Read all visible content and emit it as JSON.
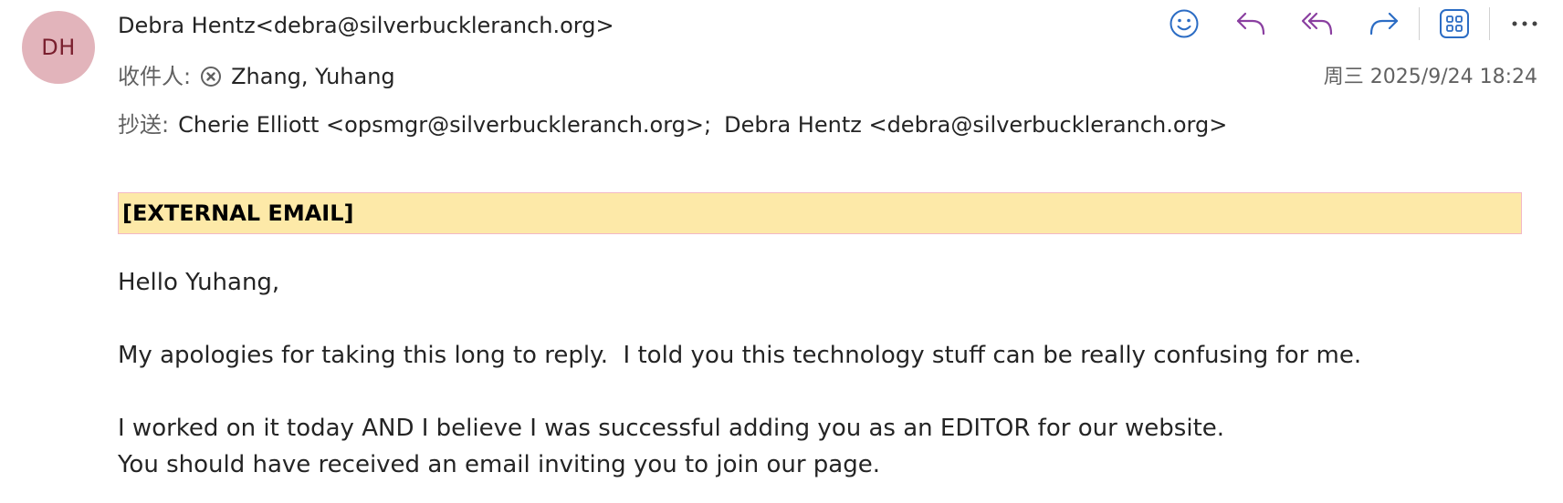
{
  "sender": {
    "initials": "DH",
    "display": "Debra Hentz<debra@silverbuckleranch.org>",
    "avatar_bg": "#e2b4bb",
    "avatar_fg": "#7a1f2e"
  },
  "to": {
    "label": "收件人:",
    "recipient": "Zhang, Yuhang"
  },
  "cc": {
    "label": "抄送:",
    "recipients": [
      "Cherie Elliott <opsmgr@silverbuckleranch.org>;",
      "Debra Hentz <debra@silverbuckleranch.org>"
    ]
  },
  "date": "周三 2025/9/24 18:24",
  "toolbar": {
    "icons": [
      "emoji-icon",
      "reply-icon",
      "reply-all-icon",
      "forward-icon",
      "apps-icon",
      "more-icon"
    ],
    "purple": "#8a3fa0",
    "blue": "#2b6cc4"
  },
  "banner": {
    "text": "[EXTERNAL EMAIL]",
    "bg": "#fde9a8"
  },
  "body": {
    "greeting": "Hello Yuhang,",
    "paragraph1": "My apologies for taking this long to reply.  I told you this technology stuff can be really confusing for me.",
    "paragraph2_line1": "I worked on it today AND I believe I was successful adding you as an EDITOR for our website.",
    "paragraph2_line2": "You should have received an email inviting you to join our page."
  }
}
